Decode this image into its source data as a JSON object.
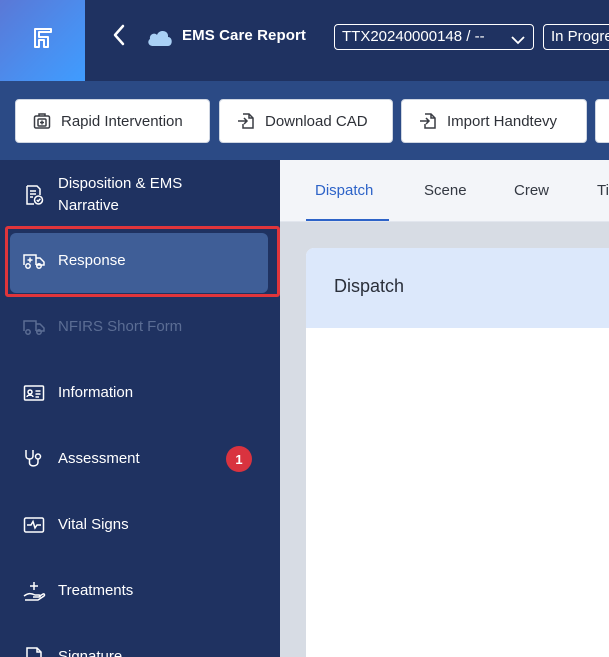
{
  "header": {
    "app_title": "EMS Care Report",
    "incident_number": "TTX20240000148 / --",
    "status": "In Progress",
    "icons": [
      "app-logo-icon",
      "back-arrow-icon",
      "cloud-icon",
      "chevron-down-icon"
    ]
  },
  "toolbar": {
    "buttons": [
      {
        "label": "Rapid Intervention",
        "icon": "medkit-icon"
      },
      {
        "label": "Download CAD",
        "icon": "import-icon"
      },
      {
        "label": "Import Handtevy",
        "icon": "import-icon"
      }
    ]
  },
  "sidebar": {
    "items": [
      {
        "label": "Disposition & EMS Narrative",
        "icon": "document-check-icon"
      },
      {
        "label": "Response",
        "icon": "ambulance-icon",
        "active": true
      },
      {
        "label": "NFIRS Short Form",
        "icon": "truck-icon",
        "disabled": true
      },
      {
        "label": "Information",
        "icon": "id-card-icon"
      },
      {
        "label": "Assessment",
        "icon": "stethoscope-icon",
        "badge": "1"
      },
      {
        "label": "Vital Signs",
        "icon": "heartbeat-monitor-icon"
      },
      {
        "label": "Treatments",
        "icon": "hand-plus-icon"
      },
      {
        "label": "Signature",
        "icon": "signature-icon"
      }
    ]
  },
  "tabs": [
    "Dispatch",
    "Scene",
    "Crew",
    "Ti"
  ],
  "active_tab": "Dispatch",
  "section": {
    "title": "Dispatch"
  },
  "colors": {
    "header_bg": "#1f3261",
    "toolbar_bg": "#2b4a85",
    "active_item_bg": "#3f5e97",
    "highlight_border": "#e0353b",
    "badge": "#d9333f",
    "tab_active": "#2d63c8",
    "section_header_bg": "#dce8fb"
  }
}
